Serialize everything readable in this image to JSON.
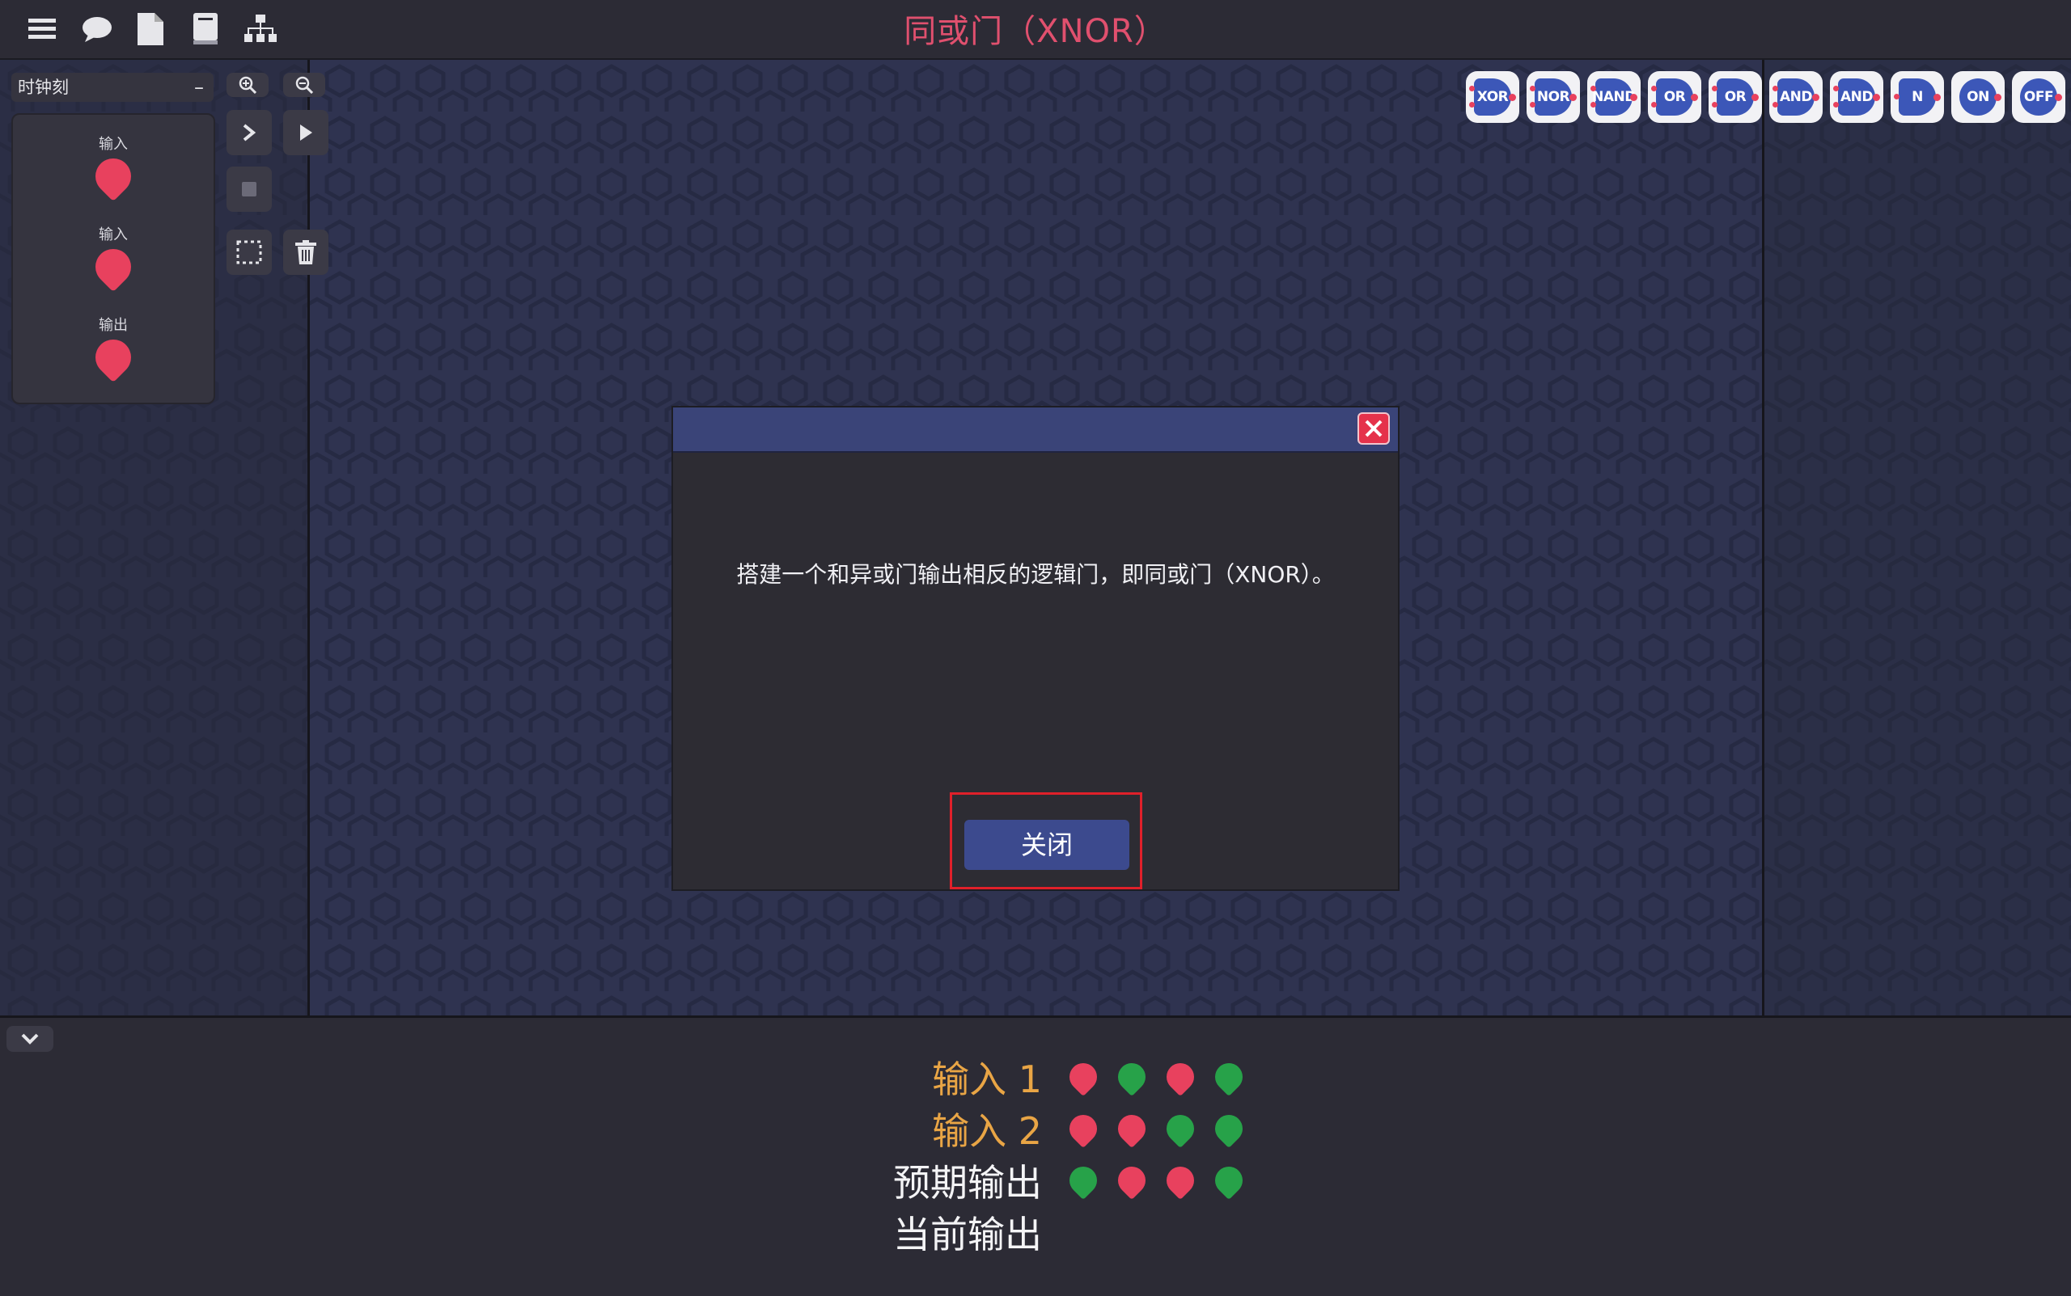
{
  "title": "同或门（XNOR）",
  "toolbar": {
    "icons": [
      "menu-icon",
      "chat-icon",
      "document-icon",
      "book-icon",
      "hierarchy-icon"
    ]
  },
  "left_panel": {
    "clock_label": "时钟刻",
    "clock_toggle": "–",
    "pins": [
      {
        "label": "输入"
      },
      {
        "label": "输入"
      },
      {
        "label": "输出"
      }
    ]
  },
  "gates": [
    {
      "label": "XOR",
      "inputs": 2
    },
    {
      "label": "NOR",
      "inputs": 2
    },
    {
      "label": "NAND",
      "inputs": 2
    },
    {
      "label": "OR",
      "inputs": 2
    },
    {
      "label": "OR",
      "inputs": 2
    },
    {
      "label": "AND",
      "inputs": 2
    },
    {
      "label": "AND",
      "inputs": 2
    },
    {
      "label": "N",
      "inputs": 1
    },
    {
      "label": "ON",
      "inputs": 0
    },
    {
      "label": "OFF",
      "inputs": 0
    }
  ],
  "modal": {
    "message": "搭建一个和异或门输出相反的逻辑门，即同或门（XNOR）。",
    "close_label": "关闭"
  },
  "truth_table": {
    "rows": [
      {
        "label": "输入 1",
        "kind": "input",
        "values": [
          0,
          1,
          0,
          1
        ]
      },
      {
        "label": "输入 2",
        "kind": "input",
        "values": [
          0,
          0,
          1,
          1
        ]
      },
      {
        "label": "预期输出",
        "kind": "output",
        "values": [
          1,
          0,
          0,
          1
        ]
      },
      {
        "label": "当前输出",
        "kind": "output",
        "values": []
      }
    ]
  },
  "colors": {
    "off": "#e8415e",
    "on": "#27a249",
    "title": "#e0506e",
    "input_label": "#e9a545"
  }
}
